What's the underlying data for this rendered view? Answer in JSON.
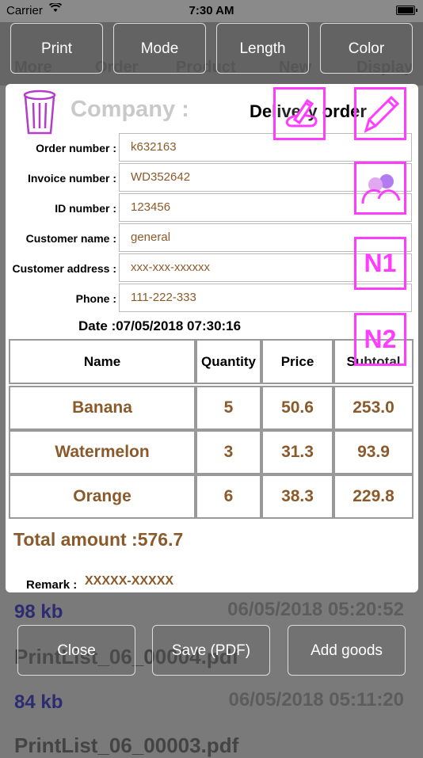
{
  "status": {
    "carrier": "Carrier",
    "time": "7:30 AM"
  },
  "background": {
    "toolbar_labels": [
      "More",
      "Order",
      "Product",
      "New",
      "Display"
    ],
    "list": [
      {
        "size": "98 kb",
        "date": "06/05/2018 05:20:52"
      },
      {
        "name": "PrintList_06_00004.pdf"
      },
      {
        "size": "84 kb",
        "date": "06/05/2018 05:11:20"
      },
      {
        "name": "PrintList_06_00003.pdf"
      }
    ]
  },
  "toolbar": {
    "print": "Print",
    "mode": "Mode",
    "length": "Length",
    "color": "Color"
  },
  "card": {
    "company": "Company :",
    "title": "Delivery order",
    "fields": [
      {
        "label": "Order number :",
        "value": "k632163"
      },
      {
        "label": "Invoice number :",
        "value": "WD352642"
      },
      {
        "label": "ID number :",
        "value": "123456"
      },
      {
        "label": "Customer name :",
        "value": "general"
      },
      {
        "label": "Customer address :",
        "value": "xxx-xxx-xxxxxx"
      },
      {
        "label": "Phone :",
        "value": "111-222-333"
      }
    ],
    "date": "Date :07/05/2018 07:30:16",
    "table": {
      "headers": [
        "Name",
        "Quantity",
        "Price",
        "Subtotal"
      ],
      "rows": [
        [
          "Banana",
          "5",
          "50.6",
          "253.0"
        ],
        [
          "Watermelon",
          "3",
          "31.3",
          "93.9"
        ],
        [
          "Orange",
          "6",
          "38.3",
          "229.8"
        ]
      ]
    },
    "total": "Total amount :576.7",
    "remark_label": "Remark :",
    "remark_value": "XXXXX-XXXXX"
  },
  "overlay": {
    "n1": "N1",
    "n2": "N2"
  },
  "bottom": {
    "close": "Close",
    "save": "Save (PDF)",
    "add": "Add goods"
  },
  "colors": {
    "accent": "#ff3dff",
    "value_text": "#8b5a2b"
  },
  "icons": [
    "trash-icon",
    "edit-signature-icon",
    "pencil-icon",
    "customer-icon"
  ]
}
